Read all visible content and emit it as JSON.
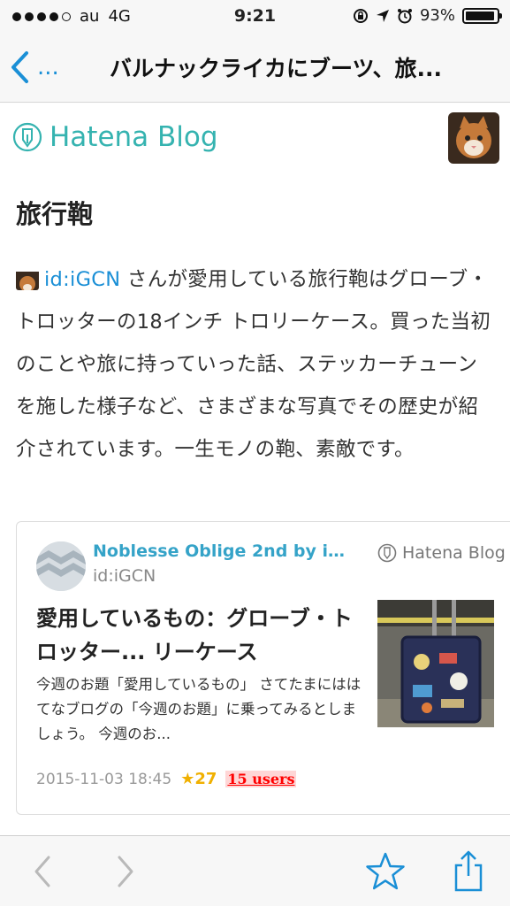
{
  "status_bar": {
    "carrier": "au",
    "network": "4G",
    "time": "9:21",
    "battery": "93%"
  },
  "nav": {
    "back_label": "...",
    "title": "バルナックライカにブーツ、旅..."
  },
  "header": {
    "logo_text": "Hatena Blog"
  },
  "entry": {
    "title": "旅行鞄",
    "user_id": "id:iGCN",
    "body": " さんが愛用している旅行鞄はグローブ・トロッターの18インチ トロリーケース。買った当初のことや旅に持っていった話、ステッカーチューンを施した様子など、さまざまな写真でその歴史が紹介されています。一生モノの鞄、素敵です。"
  },
  "card": {
    "blog_name": "Noblesse Oblige 2nd by iG...",
    "user": "id:iGCN",
    "logo_text": "Hatena Blog",
    "title": "愛用しているもの：グローブ・トロッター... リーケース",
    "excerpt": "今週のお題「愛用しているもの」 さてたまにははてなブログの「今週のお題」に乗ってみるとしましょう。 今週のお...",
    "date": "2015-11-03 18:45",
    "stars": "★27",
    "users": "15 users"
  },
  "colors": {
    "accent": "#1a8fd6",
    "brand": "#35b3b0",
    "star": "#f0b000",
    "users": "#ff0000"
  }
}
